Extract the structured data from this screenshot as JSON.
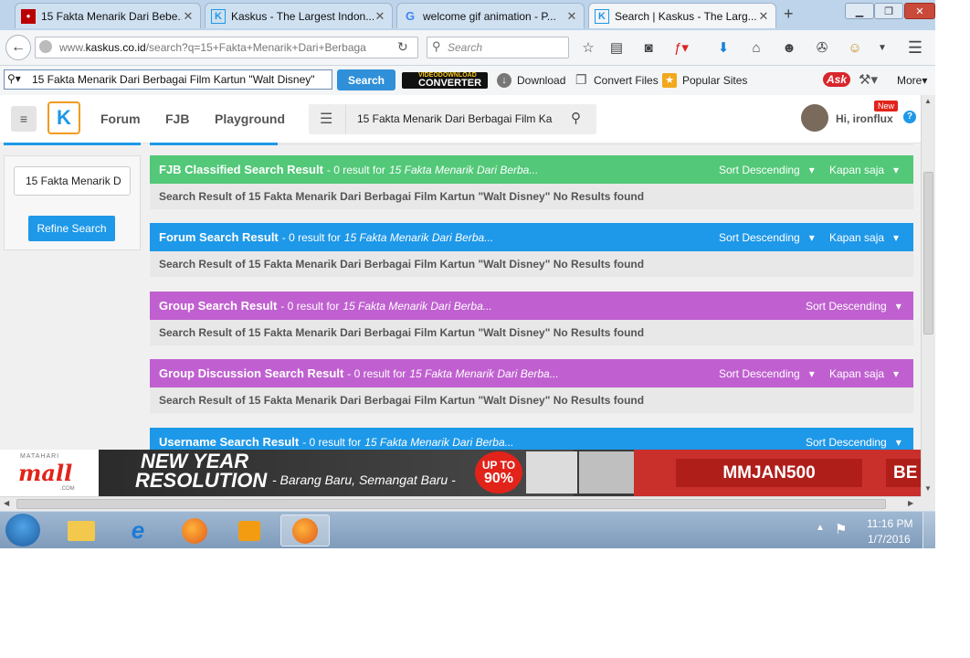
{
  "browser": {
    "tabs": [
      {
        "title": "15 Fakta Menarik Dari Bebe...",
        "favicon": "red-site-icon"
      },
      {
        "title": "Kaskus - The Largest Indon...",
        "favicon": "kaskus-icon"
      },
      {
        "title": "welcome gif animation - P...",
        "favicon": "google-icon"
      },
      {
        "title": "Search | Kaskus - The Larg...",
        "favicon": "kaskus-icon"
      }
    ],
    "new_tab": "+",
    "url_prefix": "www.",
    "url_domain": "kaskus.co.id",
    "url_rest": "/search?q=15+Fakta+Menarik+Dari+Berbaga",
    "search_placeholder": "Search"
  },
  "toolbar2": {
    "search_value": "15 Fakta Menarik Dari Berbagai Film Kartun \"Walt Disney\"",
    "search_button": "Search",
    "download": "Download",
    "convert_files": "Convert Files",
    "popular_sites": "Popular Sites",
    "ask_logo": "Ask",
    "more": "More",
    "vdc_top": "VIDEODOWNLOAD",
    "vdc_bottom": "CONVERTER"
  },
  "header": {
    "nav": [
      "Forum",
      "FJB",
      "Playground"
    ],
    "search_value": "15 Fakta Menarik Dari Berbagai Film Ka",
    "greeting": "Hi, ironflux",
    "new_badge": "New",
    "help": "?"
  },
  "sidebar": {
    "refine_value": "15 Fakta Menarik D",
    "refine_button": "Refine Search"
  },
  "sections": [
    {
      "title": "FJB Classified Search Result",
      "count": "- 0 result for",
      "term": "15 Fakta Menarik Dari Berba...",
      "sort": "Sort Descending",
      "time": "Kapan saja",
      "color": "#52c878",
      "body": "Search Result of 15 Fakta Menarik Dari Berbagai Film Kartun \"Walt Disney\" No Results found"
    },
    {
      "title": "Forum Search Result",
      "count": "- 0 result for",
      "term": "15 Fakta Menarik Dari Berba...",
      "sort": "Sort Descending",
      "time": "Kapan saja",
      "color": "#1e98e8",
      "body": "Search Result of 15 Fakta Menarik Dari Berbagai Film Kartun \"Walt Disney\" No Results found"
    },
    {
      "title": "Group Search Result",
      "count": "- 0 result for",
      "term": "15 Fakta Menarik Dari Berba...",
      "sort": "Sort Descending",
      "time": "",
      "color": "#c060d0",
      "body": "Search Result of 15 Fakta Menarik Dari Berbagai Film Kartun \"Walt Disney\" No Results found"
    },
    {
      "title": "Group Discussion Search Result",
      "count": "- 0 result for",
      "term": "15 Fakta Menarik Dari Berba...",
      "sort": "Sort Descending",
      "time": "Kapan saja",
      "color": "#c060d0",
      "body": "Search Result of 15 Fakta Menarik Dari Berbagai Film Kartun \"Walt Disney\" No Results found"
    },
    {
      "title": "Username Search Result",
      "count": "- 0 result for",
      "term": "15 Fakta Menarik Dari Berba...",
      "sort": "Sort Descending",
      "time": "",
      "color": "#1e98e8",
      "body": ""
    }
  ],
  "banner": {
    "brand_top": "MATAHARI",
    "brand": "mall",
    "brand_sub": ".COM",
    "headline1": "NEW YEAR",
    "headline2": "RESOLUTION",
    "tagline": "- Barang Baru, Semangat Baru -",
    "promo_top": "UP TO",
    "promo_value": "90%",
    "code": "MMJAN500",
    "code_partial": "BE"
  },
  "taskbar": {
    "time": "11:16 PM",
    "date": "1/7/2016"
  },
  "colors": {
    "kaskus_blue": "#1e98e8",
    "fjb_green": "#52c878",
    "group_purple": "#c060d0"
  }
}
